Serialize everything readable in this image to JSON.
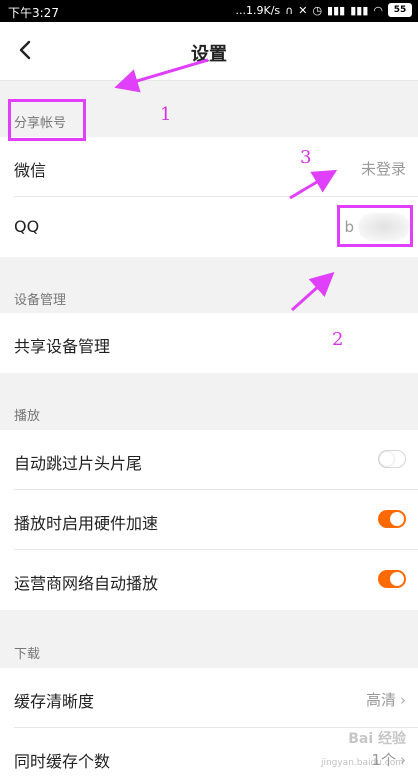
{
  "status_bar": {
    "time": "下午3:27",
    "network_speed": "...1.9K/s",
    "battery": "55"
  },
  "header": {
    "back_icon": "chevron-left-icon",
    "title": "设置"
  },
  "sections": {
    "share_account": {
      "label": "分享帐号",
      "wechat_label": "微信",
      "wechat_value": "未登录",
      "qq_label": "QQ",
      "qq_value": "b"
    },
    "device": {
      "label": "设备管理",
      "shared_device_label": "共享设备管理"
    },
    "playback": {
      "label": "播放",
      "skip_intro_label": "自动跳过片头片尾",
      "skip_intro_on": false,
      "hw_accel_label": "播放时启用硬件加速",
      "hw_accel_on": true,
      "carrier_autoplay_label": "运营商网络自动播放",
      "carrier_autoplay_on": true
    },
    "download": {
      "label": "下载",
      "cache_quality_label": "缓存清晰度",
      "cache_quality_value": "高清",
      "concurrent_cache_label": "同时缓存个数",
      "concurrent_cache_value": "1个"
    }
  },
  "annotations": {
    "n1": "1",
    "n2": "2",
    "n3": "3",
    "color": "#e040fb"
  },
  "watermark": {
    "text": "Bai 经验",
    "sub": "jingyan.baidu.com"
  },
  "colors": {
    "toggle_on": "#ff6a00",
    "background": "#f2f2f2"
  }
}
